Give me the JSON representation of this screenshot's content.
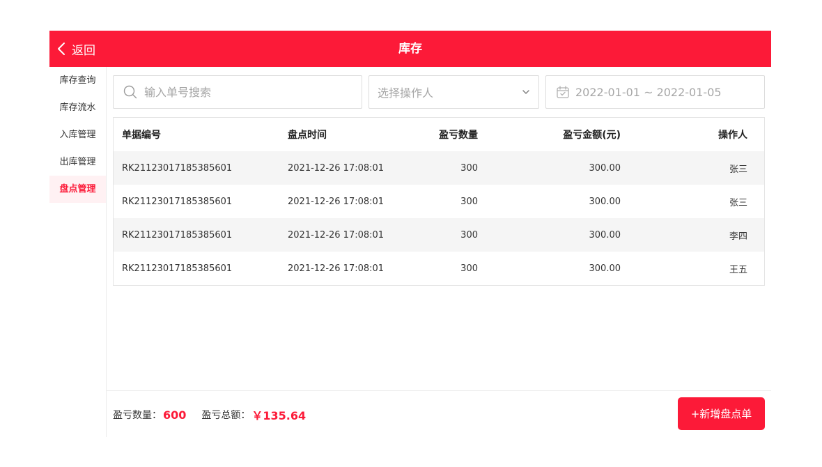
{
  "header": {
    "back_label": "返回",
    "title": "库存"
  },
  "sidebar": {
    "items": [
      {
        "label": "库存查询",
        "active": false
      },
      {
        "label": "库存流水",
        "active": false
      },
      {
        "label": "入库管理",
        "active": false
      },
      {
        "label": "出库管理",
        "active": false
      },
      {
        "label": "盘点管理",
        "active": true
      }
    ]
  },
  "filters": {
    "search_placeholder": "输入单号搜索",
    "operator_placeholder": "选择操作人",
    "date_range": "2022-01-01 ~ 2022-01-05"
  },
  "table": {
    "columns": [
      "单据编号",
      "盘点时间",
      "盈亏数量",
      "盈亏金额(元)",
      "操作人"
    ],
    "rows": [
      [
        "RK21123017185385601",
        "2021-12-26 17:08:01",
        "300",
        "300.00",
        "张三"
      ],
      [
        "RK21123017185385601",
        "2021-12-26 17:08:01",
        "300",
        "300.00",
        "张三"
      ],
      [
        "RK21123017185385601",
        "2021-12-26 17:08:01",
        "300",
        "300.00",
        "李四"
      ],
      [
        "RK21123017185385601",
        "2021-12-26 17:08:01",
        "300",
        "300.00",
        "王五"
      ]
    ]
  },
  "footer": {
    "qty_label": "盈亏数量：",
    "qty_value": "600",
    "amount_label": "盈亏总额：",
    "amount_value": "￥135.64",
    "add_button": "+新增盘点单"
  },
  "colors": {
    "accent": "#fc1a38",
    "active_bg": "#fff1f3",
    "row_shade": "#f5f5f5"
  }
}
